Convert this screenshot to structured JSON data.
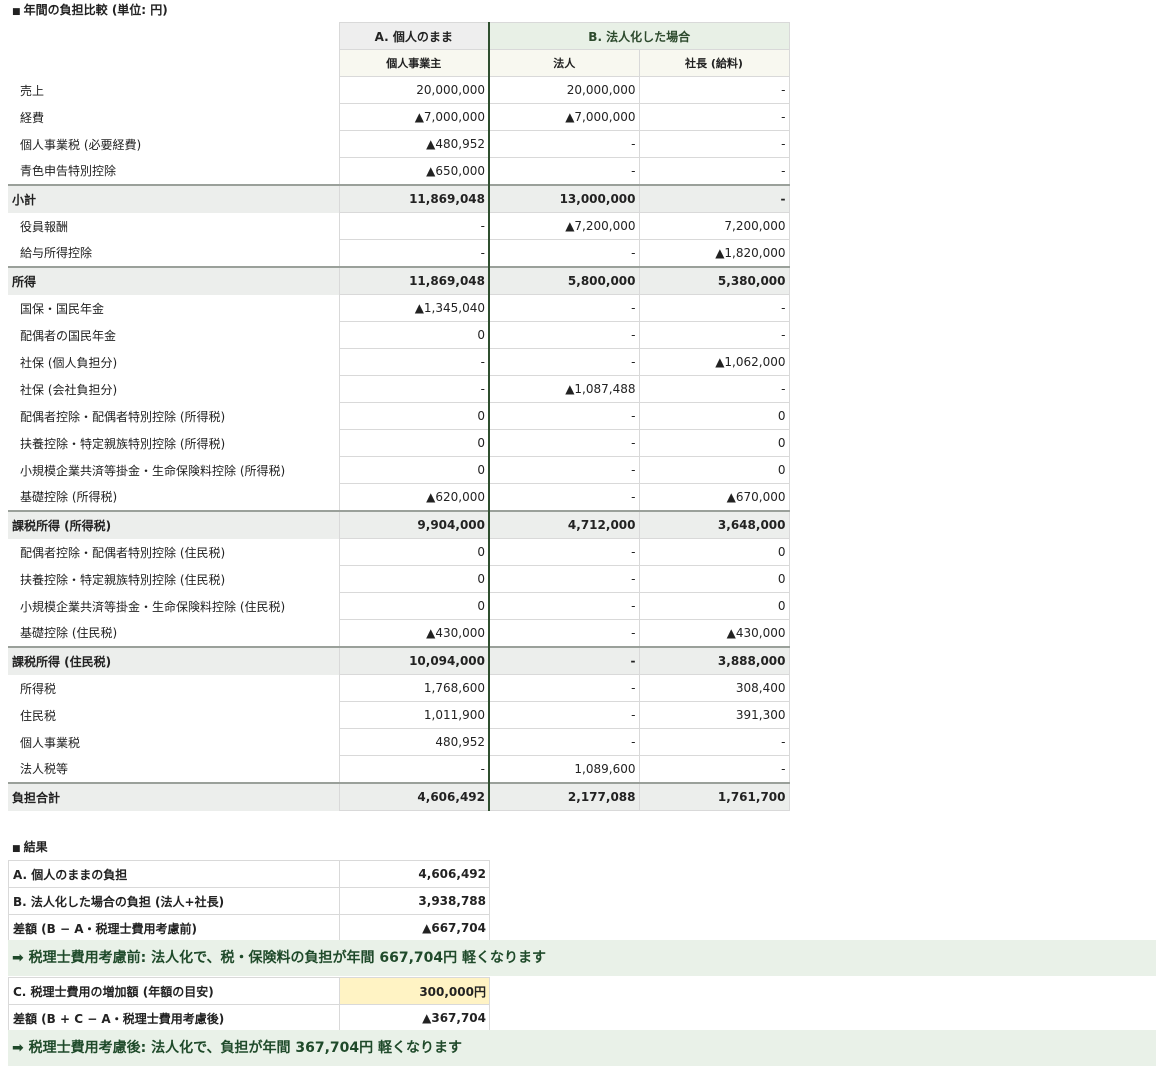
{
  "title": "年間の負担比較 (単位: 円)",
  "headers": {
    "a": "A. 個人のまま",
    "b": "B. 法人化した場合",
    "sub_a": "個人事業主",
    "sub_b1": "法人",
    "sub_b2": "社長 (給料)"
  },
  "rows": [
    {
      "label": "売上",
      "v1": "20,000,000",
      "v2": "20,000,000",
      "v3": "-",
      "sum": false
    },
    {
      "label": "経費",
      "v1": "▲7,000,000",
      "v2": "▲7,000,000",
      "v3": "-",
      "sum": false
    },
    {
      "label": "個人事業税 (必要経費)",
      "v1": "▲480,952",
      "v2": "-",
      "v3": "-",
      "sum": false
    },
    {
      "label": "青色申告特別控除",
      "v1": "▲650,000",
      "v2": "-",
      "v3": "-",
      "sum": false
    },
    {
      "label": "小計",
      "v1": "11,869,048",
      "v2": "13,000,000",
      "v3": "-",
      "sum": true
    },
    {
      "label": "役員報酬",
      "v1": "-",
      "v2": "▲7,200,000",
      "v3": "7,200,000",
      "sum": false
    },
    {
      "label": "給与所得控除",
      "v1": "-",
      "v2": "-",
      "v3": "▲1,820,000",
      "sum": false
    },
    {
      "label": "所得",
      "v1": "11,869,048",
      "v2": "5,800,000",
      "v3": "5,380,000",
      "sum": true
    },
    {
      "label": "国保・国民年金",
      "v1": "▲1,345,040",
      "v2": "-",
      "v3": "-",
      "sum": false
    },
    {
      "label": "配偶者の国民年金",
      "v1": "0",
      "v2": "-",
      "v3": "-",
      "sum": false
    },
    {
      "label": "社保 (個人負担分)",
      "v1": "-",
      "v2": "-",
      "v3": "▲1,062,000",
      "sum": false
    },
    {
      "label": "社保 (会社負担分)",
      "v1": "-",
      "v2": "▲1,087,488",
      "v3": "-",
      "sum": false
    },
    {
      "label": "配偶者控除・配偶者特別控除 (所得税)",
      "v1": "0",
      "v2": "-",
      "v3": "0",
      "sum": false
    },
    {
      "label": "扶養控除・特定親族特別控除 (所得税)",
      "v1": "0",
      "v2": "-",
      "v3": "0",
      "sum": false
    },
    {
      "label": "小規模企業共済等掛金・生命保険料控除 (所得税)",
      "v1": "0",
      "v2": "-",
      "v3": "0",
      "sum": false
    },
    {
      "label": "基礎控除 (所得税)",
      "v1": "▲620,000",
      "v2": "-",
      "v3": "▲670,000",
      "sum": false
    },
    {
      "label": "課税所得 (所得税)",
      "v1": "9,904,000",
      "v2": "4,712,000",
      "v3": "3,648,000",
      "sum": true
    },
    {
      "label": "配偶者控除・配偶者特別控除 (住民税)",
      "v1": "0",
      "v2": "-",
      "v3": "0",
      "sum": false
    },
    {
      "label": "扶養控除・特定親族特別控除 (住民税)",
      "v1": "0",
      "v2": "-",
      "v3": "0",
      "sum": false
    },
    {
      "label": "小規模企業共済等掛金・生命保険料控除 (住民税)",
      "v1": "0",
      "v2": "-",
      "v3": "0",
      "sum": false
    },
    {
      "label": "基礎控除 (住民税)",
      "v1": "▲430,000",
      "v2": "-",
      "v3": "▲430,000",
      "sum": false
    },
    {
      "label": "課税所得 (住民税)",
      "v1": "10,094,000",
      "v2": "-",
      "v3": "3,888,000",
      "sum": true
    },
    {
      "label": "所得税",
      "v1": "1,768,600",
      "v2": "-",
      "v3": "308,400",
      "sum": false
    },
    {
      "label": "住民税",
      "v1": "1,011,900",
      "v2": "-",
      "v3": "391,300",
      "sum": false
    },
    {
      "label": "個人事業税",
      "v1": "480,952",
      "v2": "-",
      "v3": "-",
      "sum": false
    },
    {
      "label": "法人税等",
      "v1": "-",
      "v2": "1,089,600",
      "v3": "-",
      "sum": false
    },
    {
      "label": "負担合計",
      "v1": "4,606,492",
      "v2": "2,177,088",
      "v3": "1,761,700",
      "sum": true
    }
  ],
  "result": {
    "title": "結果",
    "row_a_label": "A. 個人のままの負担",
    "row_a_value": "4,606,492",
    "row_b_label": "B. 法人化した場合の負担 (法人+社長)",
    "row_b_value": "3,938,788",
    "diff1_label": "差額 (B − A・税理士費用考慮前)",
    "diff1_value": "▲667,704",
    "banner1": "➡ 税理士費用考慮前: 法人化で、税・保険料の負担が年間 667,704円 軽くなります",
    "row_c_label": "C. 税理士費用の増加額 (年額の目安)",
    "row_c_value": "300,000円",
    "diff2_label": "差額 (B + C − A・税理士費用考慮後)",
    "diff2_value": "▲367,704",
    "banner2": "➡ 税理士費用考慮後: 法人化で、負担が年間 367,704円 軽くなります"
  }
}
